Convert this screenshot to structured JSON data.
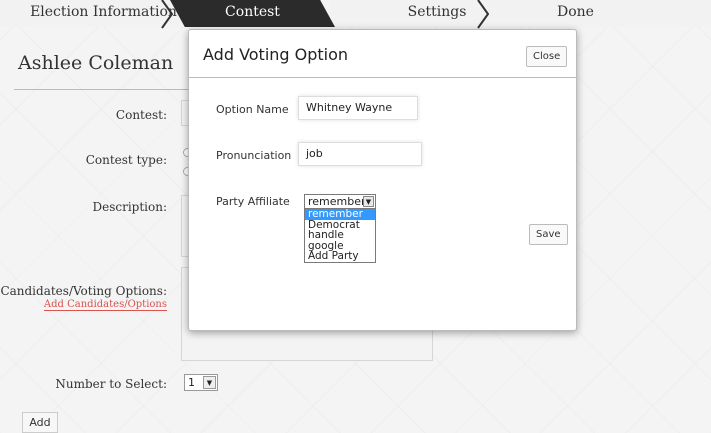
{
  "wizard": {
    "steps": [
      "Election Information",
      "Contest",
      "Settings",
      "Done"
    ],
    "active_step": "Contest"
  },
  "contest_form": {
    "user_name": "Ashlee Coleman",
    "labels": {
      "contest": "Contest:",
      "contest_type": "Contest type:",
      "description": "Description:",
      "candidates": "Candidates/Voting Options:",
      "number_to_select": "Number to Select:"
    },
    "add_candidates_link": "Add Candidates/Options",
    "number_to_select_value": "1",
    "add_button": "Add"
  },
  "modal": {
    "title": "Add Voting Option",
    "close_label": "Close",
    "fields": {
      "option_name_label": "Option Name",
      "option_name_value": "Whitney Wayne",
      "pronunciation_label": "Pronunciation",
      "pronunciation_value": "job",
      "party_label": "Party Affiliate",
      "party_value": "remember"
    },
    "party_options": [
      "remember",
      "Democrat",
      "handle",
      "google",
      "Add Party"
    ],
    "party_highlighted": "remember",
    "save_label": "Save"
  },
  "colors": {
    "active_step_bg": "#2b2b2b",
    "link_red": "#d9534f",
    "select_highlight": "#3399ff"
  }
}
